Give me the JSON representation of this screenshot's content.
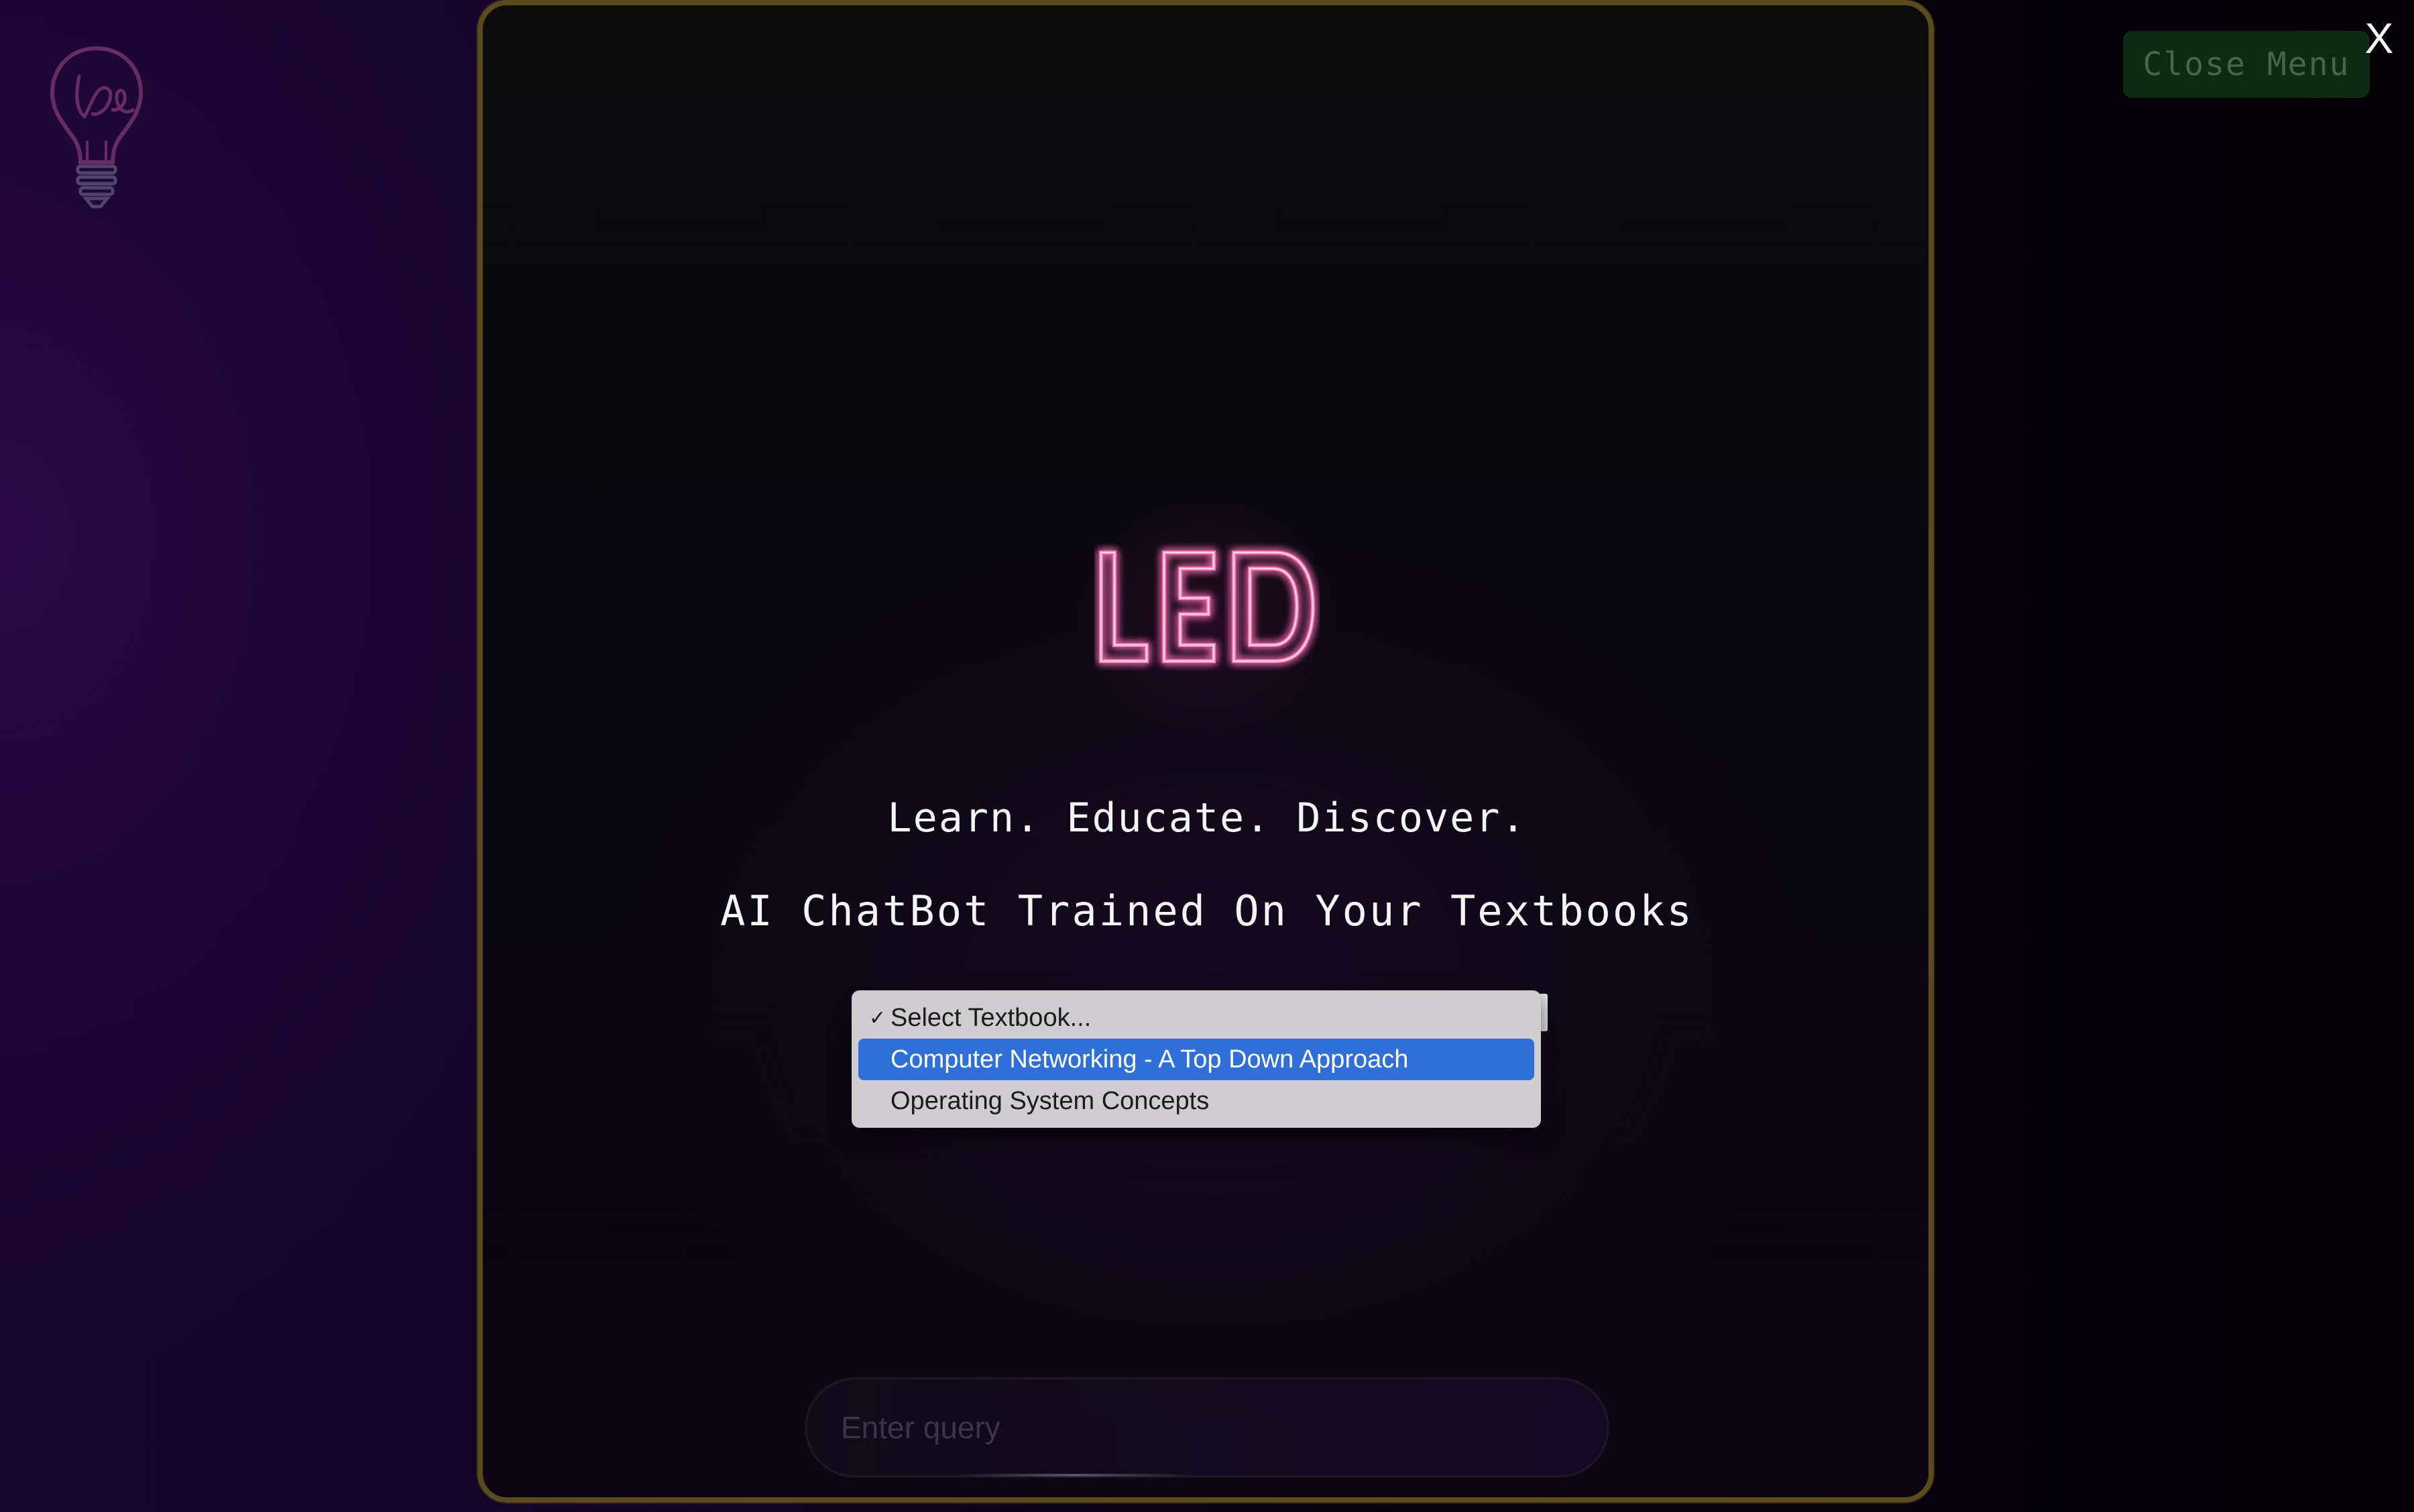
{
  "header": {
    "logo_icon": "lightbulb-led-logo-icon",
    "logo_text": "Led",
    "close_menu_label": "Close Menu",
    "close_x_label": "X"
  },
  "hero": {
    "logo_text": "LED",
    "tagline": "Learn. Educate. Discover.",
    "subtitle": "AI ChatBot Trained On Your Textbooks"
  },
  "textbook_select": {
    "options": [
      {
        "label": "Select Textbook...",
        "checked": true,
        "highlighted": false
      },
      {
        "label": "Computer Networking - A Top Down Approach",
        "checked": false,
        "highlighted": true
      },
      {
        "label": "Operating System Concepts",
        "checked": false,
        "highlighted": false
      }
    ],
    "check_glyph": "✓"
  },
  "query": {
    "placeholder": "Enter query"
  },
  "colors": {
    "neon_pink": "#ff4fa3",
    "modal_border": "#5a4a1c",
    "highlight": "#2f6fd9",
    "close_menu_bg": "#0f2a12"
  }
}
